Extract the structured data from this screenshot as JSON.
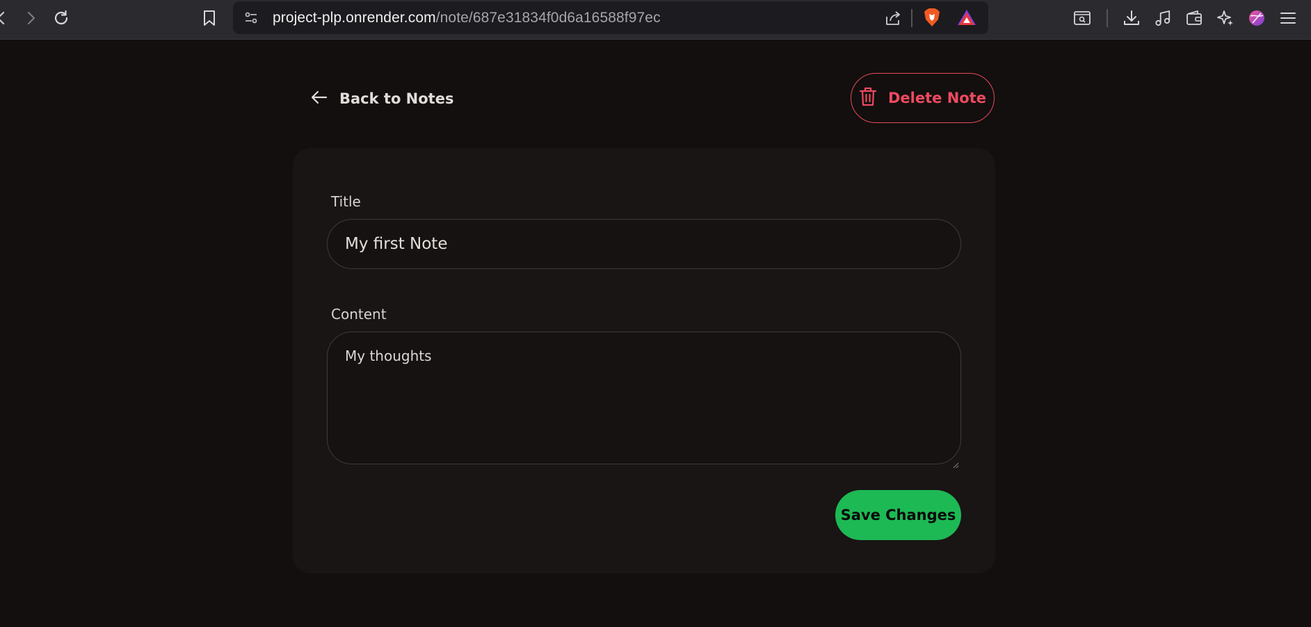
{
  "browser": {
    "url_host": "project-plp.onrender.com",
    "url_path": "/note/687e31834f0d6a16588f97ec"
  },
  "page": {
    "back_label": "Back to Notes",
    "delete_label": "Delete Note",
    "title_label": "Title",
    "title_value": "My first Note",
    "content_label": "Content",
    "content_value": "My thoughts",
    "save_label": "Save Changes"
  },
  "colors": {
    "background": "#120f0e",
    "card": "#181514",
    "danger": "#ef4a60",
    "save": "#1db954"
  }
}
